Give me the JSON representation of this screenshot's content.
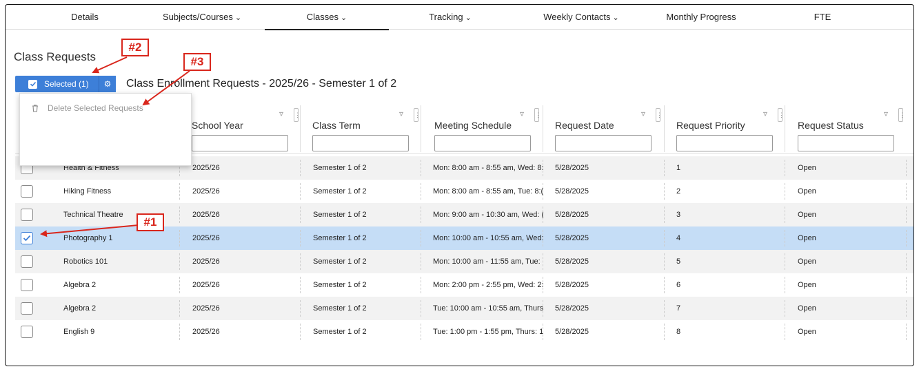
{
  "tabs": [
    {
      "label": "Details",
      "chevron": false
    },
    {
      "label": "Subjects/Courses",
      "chevron": true
    },
    {
      "label": "Classes",
      "chevron": true,
      "active": true
    },
    {
      "label": "Tracking",
      "chevron": true
    },
    {
      "label": "Weekly Contacts",
      "chevron": true
    },
    {
      "label": "Monthly Progress",
      "chevron": false
    },
    {
      "label": "FTE",
      "chevron": false
    }
  ],
  "page_title": "Class Requests",
  "toolbar": {
    "selected_label": "Selected (1)",
    "gear_icon": "gear-icon",
    "table_title": "Class Enrollment Requests - 2025/26 - Semester 1 of 2"
  },
  "dropdown": {
    "items": [
      {
        "label": "Delete Selected Requests",
        "icon": "trash-icon",
        "enabled": false
      }
    ]
  },
  "columns": [
    "School Year",
    "Class Term",
    "Meeting Schedule",
    "Request Date",
    "Request Priority",
    "Request Status"
  ],
  "rows": [
    {
      "checked": false,
      "class_name": "Health & Fitness",
      "school_year": "2025/26",
      "term": "Semester 1 of 2",
      "schedule": "Mon: 8:00 am - 8:55 am, Wed: 8:",
      "date": "5/28/2025",
      "priority": "1",
      "status": "Open"
    },
    {
      "checked": false,
      "class_name": "Hiking Fitness",
      "school_year": "2025/26",
      "term": "Semester 1 of 2",
      "schedule": "Mon: 8:00 am - 8:55 am, Tue: 8:(",
      "date": "5/28/2025",
      "priority": "2",
      "status": "Open"
    },
    {
      "checked": false,
      "class_name": "Technical Theatre",
      "school_year": "2025/26",
      "term": "Semester 1 of 2",
      "schedule": "Mon: 9:00 am - 10:30 am, Wed: (",
      "date": "5/28/2025",
      "priority": "3",
      "status": "Open"
    },
    {
      "checked": true,
      "class_name": "Photography 1",
      "school_year": "2025/26",
      "term": "Semester 1 of 2",
      "schedule": "Mon: 10:00 am - 10:55 am, Wed:",
      "date": "5/28/2025",
      "priority": "4",
      "status": "Open"
    },
    {
      "checked": false,
      "class_name": "Robotics 101",
      "school_year": "2025/26",
      "term": "Semester 1 of 2",
      "schedule": "Mon: 10:00 am - 11:55 am, Tue:",
      "date": "5/28/2025",
      "priority": "5",
      "status": "Open"
    },
    {
      "checked": false,
      "class_name": "Algebra 2",
      "school_year": "2025/26",
      "term": "Semester 1 of 2",
      "schedule": "Mon: 2:00 pm - 2:55 pm, Wed: 2:",
      "date": "5/28/2025",
      "priority": "6",
      "status": "Open"
    },
    {
      "checked": false,
      "class_name": "Algebra 2",
      "school_year": "2025/26",
      "term": "Semester 1 of 2",
      "schedule": "Tue: 10:00 am - 10:55 am, Thurs",
      "date": "5/28/2025",
      "priority": "7",
      "status": "Open"
    },
    {
      "checked": false,
      "class_name": "English 9",
      "school_year": "2025/26",
      "term": "Semester 1 of 2",
      "schedule": "Tue: 1:00 pm - 1:55 pm, Thurs: 1",
      "date": "5/28/2025",
      "priority": "8",
      "status": "Open"
    }
  ],
  "annotations": [
    "#1",
    "#2",
    "#3"
  ],
  "colors": {
    "accent": "#3d7fd8",
    "selected_row": "#c5ddf6",
    "annotation": "#d9261c"
  }
}
